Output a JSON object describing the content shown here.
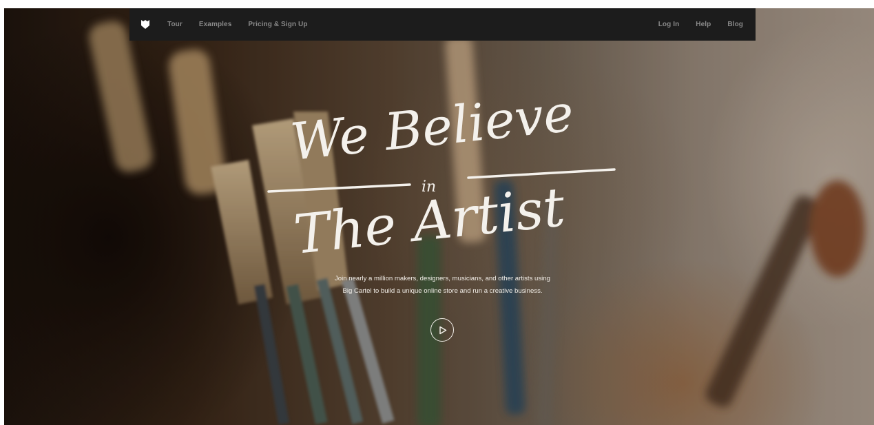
{
  "nav": {
    "brand_icon": "big-cartel-shield-icon",
    "left_links": [
      "Tour",
      "Examples",
      "Pricing & Sign Up"
    ],
    "right_links": [
      "Log In",
      "Help",
      "Blog"
    ]
  },
  "hero": {
    "headline_line1": "We Believe",
    "headline_connector": "in",
    "headline_line2": "The Artist",
    "subtext_line1": "Join nearly a million makers, designers, musicians, and other artists using",
    "subtext_line2": "Big Cartel to build a unique online store and run a creative business.",
    "play_icon": "play-icon"
  },
  "colors": {
    "navbar_bg": "#1c1c1c",
    "nav_link": "#8a8a8a",
    "hero_text": "#f4f1ec"
  }
}
